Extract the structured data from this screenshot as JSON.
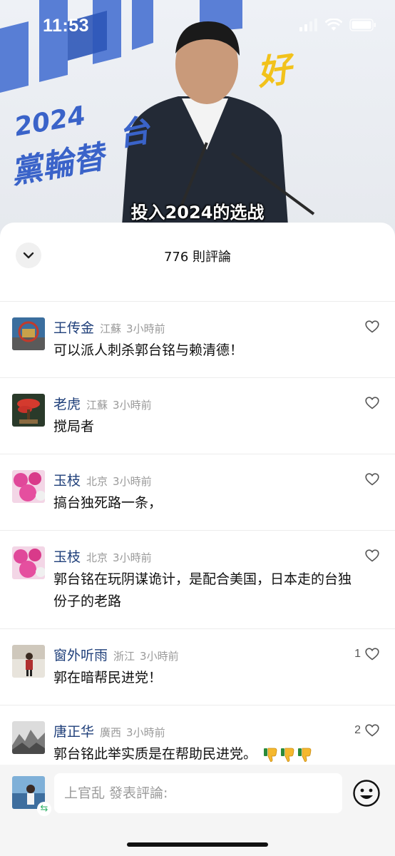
{
  "status_bar": {
    "time": "11:53"
  },
  "video": {
    "banner_year": "2024",
    "banner_text": "黨輪替",
    "banner_text2": "台",
    "banner_text3": "好",
    "subtitle": "投入2024的选战"
  },
  "sheet": {
    "title": "776 則評論"
  },
  "comments": [
    {
      "name": "王传金",
      "location": "江蘇",
      "time": "3小時前",
      "text": "可以派人刺杀郭台铭与赖清德！",
      "likes": ""
    },
    {
      "name": "老虎",
      "location": "江蘇",
      "time": "3小時前",
      "text": "搅局者",
      "likes": ""
    },
    {
      "name": "玉枝",
      "location": "北京",
      "time": "3小時前",
      "text": "搞台独死路一条，",
      "likes": ""
    },
    {
      "name": "玉枝",
      "location": "北京",
      "time": "3小時前",
      "text": "郭台铭在玩阴谋诡计，是配合美国，日本走的台独份子的老路",
      "likes": ""
    },
    {
      "name": "窗外听雨",
      "location": "浙江",
      "time": "3小時前",
      "text": "郭在暗帮民进党！",
      "likes": "1"
    },
    {
      "name": "唐正华",
      "location": "廣西",
      "time": "3小時前",
      "text": "郭台铭此举实质是在帮助民进党。",
      "likes": "2"
    }
  ],
  "input": {
    "placeholder": "上官乱 發表評論:"
  },
  "icons": {
    "collapse": "chevron-down-icon",
    "like": "heart-outline-icon",
    "emoji": "smiley-icon",
    "share": "share-arrows-icon",
    "thumbs": "thumbs-down-emoji-icon"
  },
  "colors": {
    "name_blue": "#1f3f7a",
    "meta_gray": "#9a9a9a",
    "banner_blue": "#3a63c9",
    "banner_yellow": "#f2c21b"
  }
}
